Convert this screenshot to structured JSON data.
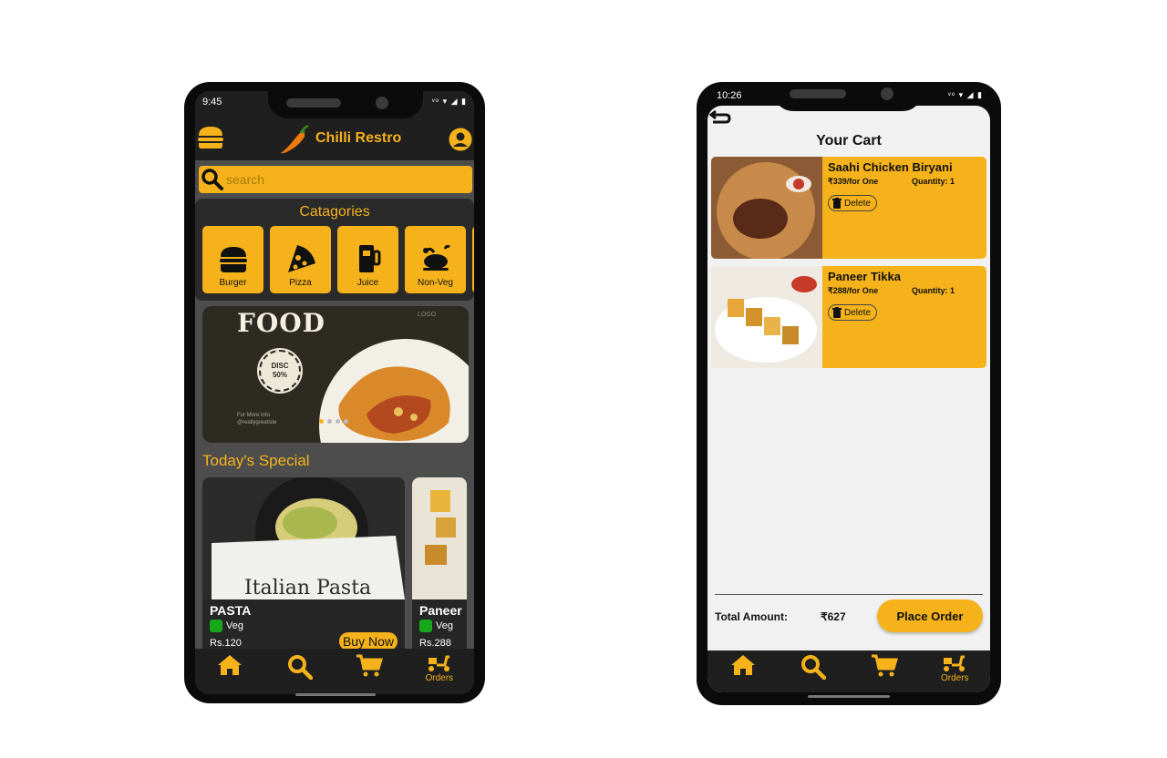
{
  "colors": {
    "accent": "#f5b21a",
    "dark": "#1f1f1f",
    "panel": "#4d4d4d",
    "veg": "#16a81a"
  },
  "menu_screen": {
    "status": {
      "time": "9:45",
      "icons": "ᵛᵒ ▾ ◢ ▮"
    },
    "header": {
      "brand": "Chilli Restro",
      "menu_icon": "burger-icon",
      "profile_icon": "user-circle-icon"
    },
    "search": {
      "placeholder": "search"
    },
    "categories": {
      "title": "Catagories",
      "items": [
        {
          "label": "Burger",
          "icon": "burger-icon"
        },
        {
          "label": "Pizza",
          "icon": "pizza-icon"
        },
        {
          "label": "Juice",
          "icon": "juice-icon"
        },
        {
          "label": "Non-Veg",
          "icon": "chicken-icon"
        }
      ]
    },
    "banner": {
      "title": "FOOD",
      "logo": "LOGO",
      "badge_line1": "DISC",
      "badge_line2": "50%",
      "info_line1": "For More Info",
      "info_line2": "@reallygreatsite"
    },
    "special": {
      "title": "Today's Special",
      "items": [
        {
          "name": "PASTA",
          "type": "Veg",
          "price": "Rs.120",
          "caption": "Italian Pasta",
          "button": "Buy Now"
        },
        {
          "name": "Paneer",
          "type": "Veg",
          "price": "Rs.288"
        }
      ]
    },
    "nav": {
      "orders_label": "Orders"
    }
  },
  "cart_screen": {
    "status": {
      "time": "10:26",
      "icons": "ᵛᵒ ▾ ◢ ▮"
    },
    "title": "Your Cart",
    "items": [
      {
        "name": "Saahi Chicken Biryani",
        "price": "₹339/for One",
        "quantity": "Quantity: 1",
        "delete_label": "Delete"
      },
      {
        "name": "Paneer Tikka",
        "price": "₹288/for One",
        "quantity": "Quantity: 1",
        "delete_label": "Delete"
      }
    ],
    "total_label": "Total Amount:",
    "total_value": "₹627",
    "place_order": "Place Order",
    "nav": {
      "orders_label": "Orders"
    }
  }
}
